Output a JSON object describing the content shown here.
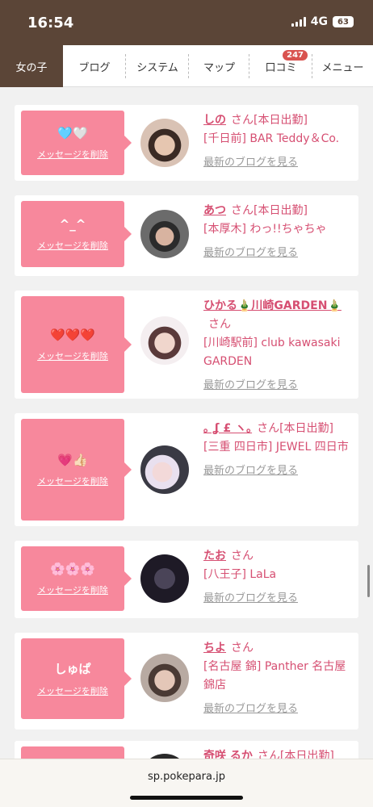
{
  "status": {
    "time": "16:54",
    "network": "4G",
    "battery": "63"
  },
  "tabs": [
    {
      "label": "女の子",
      "active": true
    },
    {
      "label": "ブログ"
    },
    {
      "label": "システム"
    },
    {
      "label": "マップ"
    },
    {
      "label": "口コミ",
      "badge": "247"
    },
    {
      "label": "メニュー"
    }
  ],
  "cards": [
    {
      "message": "🩵🤍",
      "delete_label": "メッセージを削除",
      "name": "しの",
      "san": "さん",
      "tag": "[本日出勤]",
      "shop": "[千日前] BAR Teddy＆Co.",
      "blog_label": "最新のブログを見る"
    },
    {
      "message": "^_^",
      "delete_label": "メッセージを削除",
      "name": "あつ",
      "san": "さん",
      "tag": "[本日出勤]",
      "shop": "[本厚木] わっ!!ちゃちゃ",
      "blog_label": "最新のブログを見る"
    },
    {
      "message": "❤️❤️❤️",
      "delete_label": "メッセージを削除",
      "name": "ひかる🎍川崎GARDEN🎍",
      "san": "さん",
      "tag": "",
      "shop": "[川崎駅前] club kawasaki GARDEN",
      "blog_label": "最新のブログを見る"
    },
    {
      "message": "💗👍🏻",
      "delete_label": "メッセージを削除",
      "name": "｡ ʆ £ ヽ｡",
      "san": "さん",
      "tag": "[本日出勤]",
      "shop": "[三重 四日市] JEWEL 四日市",
      "blog_label": "最新のブログを見る"
    },
    {
      "message": "🌸🌸🌸",
      "delete_label": "メッセージを削除",
      "name": "たお",
      "san": "さん",
      "tag": "",
      "shop": "[八王子] LaLa",
      "blog_label": "最新のブログを見る"
    },
    {
      "message": "しゅぱ",
      "delete_label": "メッセージを削除",
      "name": "ちよ",
      "san": "さん",
      "tag": "",
      "shop": "[名古屋 錦] Panther 名古屋錦店",
      "blog_label": "最新のブログを見る"
    },
    {
      "message": "",
      "delete_label": "",
      "name": "奇咲 るか",
      "san": "さん",
      "tag": "[本日出勤]",
      "shop": "",
      "blog_label": ""
    }
  ],
  "browser": {
    "url": "sp.pokepara.jp"
  },
  "colors": {
    "brown": "#5b4537",
    "pink": "#f7889c",
    "text_pink": "#d64f72"
  }
}
